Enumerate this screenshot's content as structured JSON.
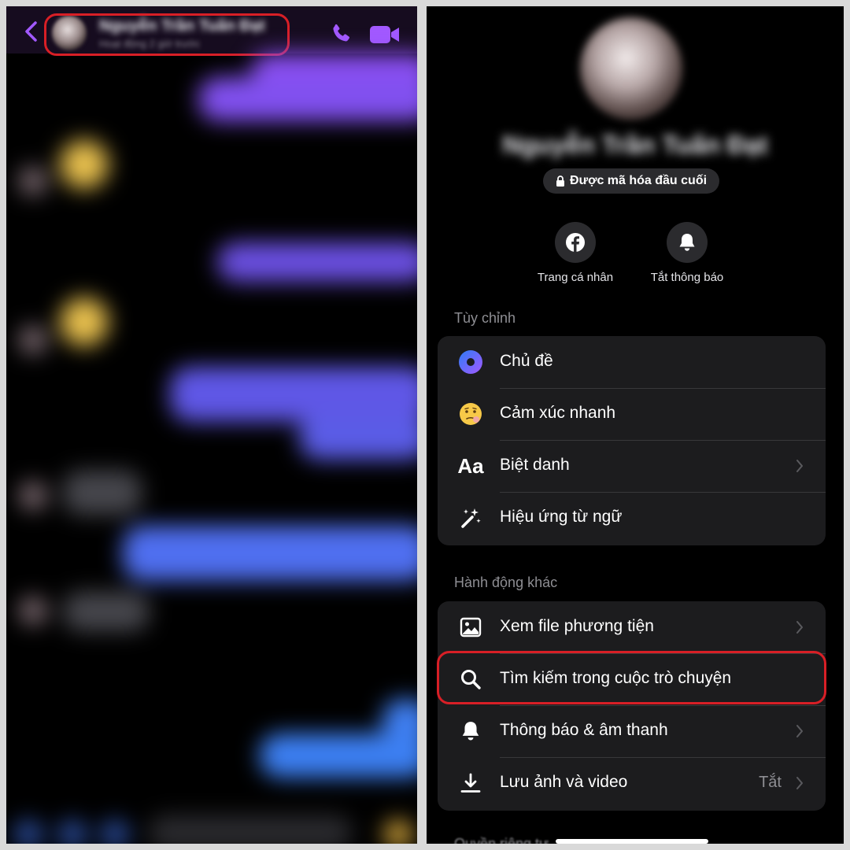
{
  "chat": {
    "contact_name": "Nguyễn Trần Tuấn Đạt",
    "contact_status": "Hoạt động 2 giờ trước"
  },
  "profile": {
    "name": "Nguyễn Trần Tuấn Đạt",
    "encryption_badge": "Được mã hóa đầu cuối",
    "actions": [
      {
        "label": "Trang cá nhân",
        "icon": "facebook-icon"
      },
      {
        "label": "Tắt thông báo",
        "icon": "bell-icon"
      }
    ]
  },
  "sections": [
    {
      "title": "Tùy chỉnh",
      "items": [
        {
          "label": "Chủ đề",
          "icon": "theme-icon",
          "chevron": false
        },
        {
          "label": "Cảm xúc nhanh",
          "icon": "quick-reaction-emoji-icon",
          "chevron": false
        },
        {
          "label": "Biệt danh",
          "icon": "nickname-aa-icon",
          "chevron": true
        },
        {
          "label": "Hiệu ứng từ ngữ",
          "icon": "magic-wand-icon",
          "chevron": false
        }
      ]
    },
    {
      "title": "Hành động khác",
      "items": [
        {
          "label": "Xem file phương tiện",
          "icon": "image-icon",
          "chevron": true
        },
        {
          "label": "Tìm kiếm trong cuộc trò chuyện",
          "icon": "search-icon",
          "chevron": false,
          "highlighted": true
        },
        {
          "label": "Thông báo & âm thanh",
          "icon": "bell-icon",
          "chevron": true
        },
        {
          "label": "Lưu ảnh và video",
          "icon": "download-icon",
          "chevron": true,
          "value": "Tắt"
        }
      ]
    }
  ],
  "next_section_title_partial": "Quyền riêng tư",
  "colors": {
    "messenger_accent": "#a259ff",
    "highlight_outline": "#d81f26",
    "row_background": "#1c1c1e",
    "badge_background": "#2b2b2e"
  }
}
